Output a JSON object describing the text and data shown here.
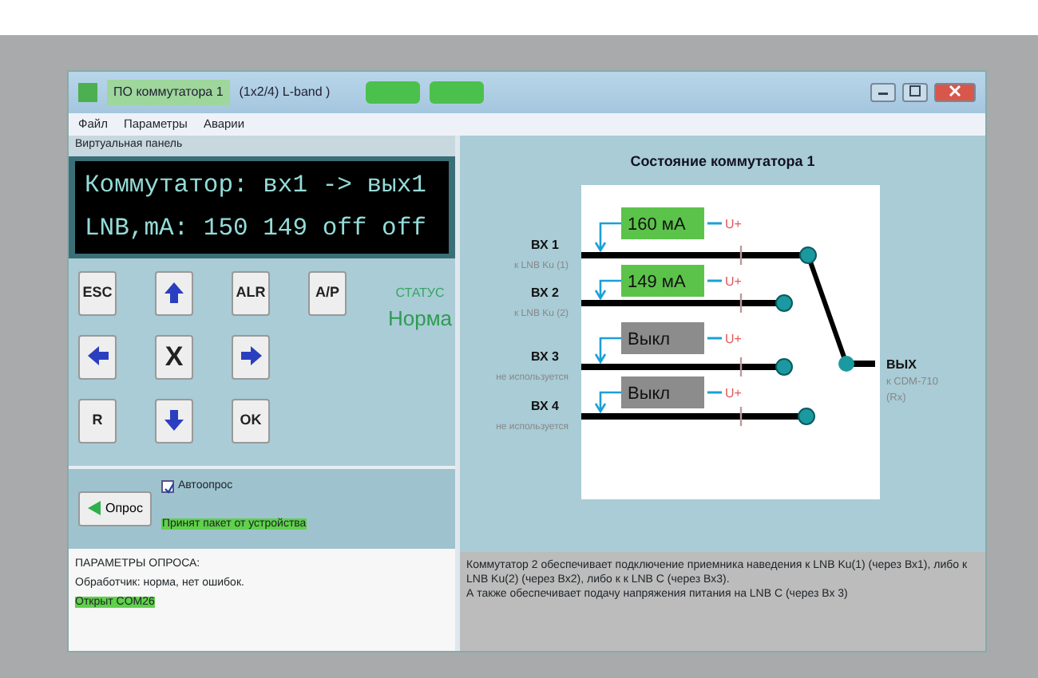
{
  "window": {
    "title": "ПО коммутатора 1",
    "subtitle": "(1x2/4) L-band )"
  },
  "menu": [
    "Файл",
    "Параметры",
    "Аварии"
  ],
  "virtual_panel": {
    "title": "Виртуальная панель",
    "display": [
      "Коммутатор: вх1 -> вых1",
      "LNB,mA: 150 149 off off"
    ],
    "buttons": [
      {
        "kind": "text",
        "label": "ESC"
      },
      {
        "kind": "up"
      },
      {
        "kind": "text",
        "label": "ALR"
      },
      {
        "kind": "text",
        "label": "A/P"
      },
      {
        "kind": "left"
      },
      {
        "kind": "text",
        "label": "X"
      },
      {
        "kind": "right"
      },
      {
        "kind": "none"
      },
      {
        "kind": "text",
        "label": "R"
      },
      {
        "kind": "down"
      },
      {
        "kind": "text",
        "label": "OK"
      },
      {
        "kind": "none"
      }
    ],
    "status_label": "СТАТУС",
    "status_value": "Норма"
  },
  "poll": {
    "button": "Опрос",
    "autopoll": {
      "label": "Автоопрос",
      "checked": true
    },
    "message": "Принят пакет от устройства"
  },
  "params": {
    "title": "ПАРАМЕТРЫ ОПРОСА:",
    "lines": [
      {
        "text": "Обработчик: норма, нет ошибок.",
        "highlighted": false
      },
      {
        "text": "Открыт COM26",
        "highlighted": true
      }
    ]
  },
  "diagram": {
    "title": "Состояние коммутатора 1",
    "inputs": [
      {
        "label": "ВХ 1",
        "sublabel": "к LNB Ku (1)",
        "reading": "160 мА",
        "on": true,
        "voltage": "U+",
        "selected": true
      },
      {
        "label": "ВХ 2",
        "sublabel": "к LNB Ku (2)",
        "reading": "149 мА",
        "on": true,
        "voltage": "U+",
        "selected": false
      },
      {
        "label": "ВХ 3",
        "sublabel": "не используется",
        "reading": "Выкл",
        "on": false,
        "voltage": "U+",
        "selected": false
      },
      {
        "label": "ВХ 4",
        "sublabel": "не используется",
        "reading": "Выкл",
        "on": false,
        "voltage": "U+",
        "selected": false
      }
    ],
    "output": {
      "label": "ВЫХ",
      "lines": [
        "к CDM-710",
        "(Rx)"
      ]
    }
  },
  "info": [
    "Коммутатор 2 обеспечивает подключение приемника наведения к LNB Ku(1) (через Вх1), либо к LNB Ku(2) (через Вх2), либо к к LNB C (через Вх3).",
    "А также обеспечивает подачу напряжения питания на LNB C (через Вх 3)"
  ]
}
